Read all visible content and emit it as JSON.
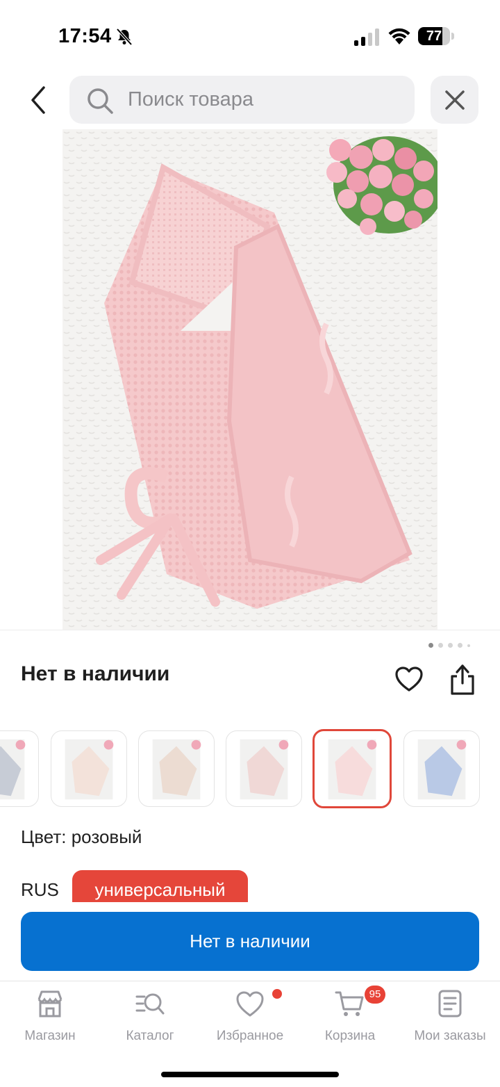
{
  "status_bar": {
    "time": "17:54",
    "battery_percent": "77",
    "battery_level": 0.77
  },
  "search": {
    "placeholder": "Поиск товара",
    "value": ""
  },
  "product": {
    "stock_title": "Нет в наличии",
    "image_pager": {
      "total_dots": 5,
      "active_index": 0
    },
    "thumbnails": [
      {
        "color": "#c7ccd6",
        "selected": false
      },
      {
        "color": "#f3e2da",
        "selected": false
      },
      {
        "color": "#ecdcd2",
        "selected": false
      },
      {
        "color": "#f0d8d6",
        "selected": false
      },
      {
        "color": "#f7dcdc",
        "selected": true
      },
      {
        "color": "#b9c9e6",
        "selected": false
      }
    ],
    "color_line": "Цвет: розовый",
    "size_label": "RUS",
    "size_chip": "универсальный",
    "cta_label": "Нет в наличии"
  },
  "bottom_nav": {
    "tabs": [
      {
        "label": "Магазин",
        "icon": "store-icon"
      },
      {
        "label": "Каталог",
        "icon": "catalog-search-icon"
      },
      {
        "label": "Избранное",
        "icon": "heart-icon"
      },
      {
        "label": "Корзина",
        "icon": "cart-icon"
      },
      {
        "label": "Мои заказы",
        "icon": "orders-icon"
      }
    ],
    "cart_badge": "95",
    "favorites_has_dot": true
  },
  "colors": {
    "accent_blue": "#0771d0",
    "accent_red": "#e5463a",
    "tab_gray": "#9a9aa0"
  }
}
